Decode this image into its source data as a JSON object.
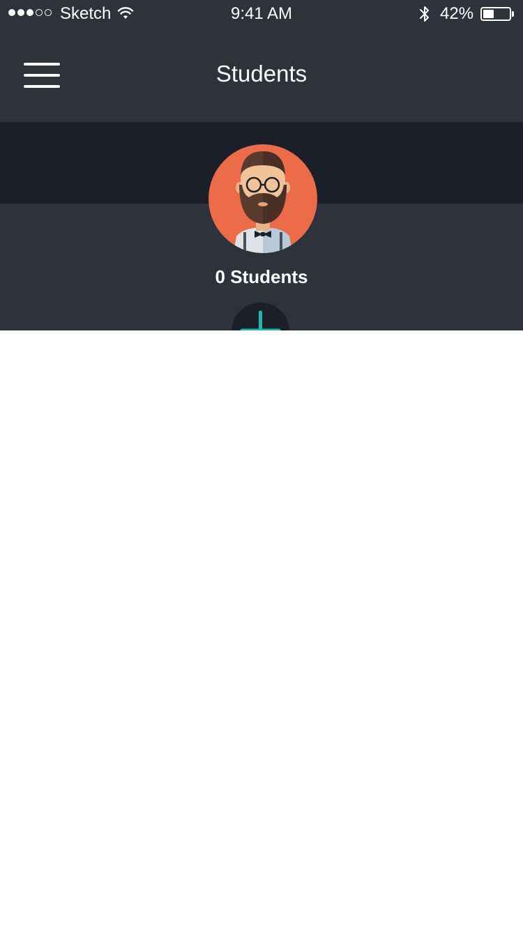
{
  "status_bar": {
    "carrier": "Sketch",
    "time": "9:41 AM",
    "battery_percent_text": "42%",
    "battery_level": 0.42,
    "signal_bars_filled": 3,
    "signal_bars_total": 5,
    "icons": [
      "signal-dots-icon",
      "wifi-icon",
      "bluetooth-icon",
      "battery-icon"
    ]
  },
  "nav": {
    "title": "Students",
    "menu_icon": "hamburger-menu-icon"
  },
  "profile": {
    "avatar_icon": "bearded-man-avatar-icon",
    "count_label": "0 Students"
  },
  "actions": {
    "add_icon": "plus-icon"
  },
  "colors": {
    "header_bg": "#2d323b",
    "band_dark": "#1b1f28",
    "avatar_bg": "#ec6c4a",
    "accent_teal": "#1fb8b0",
    "content_bg": "#ffffff"
  }
}
